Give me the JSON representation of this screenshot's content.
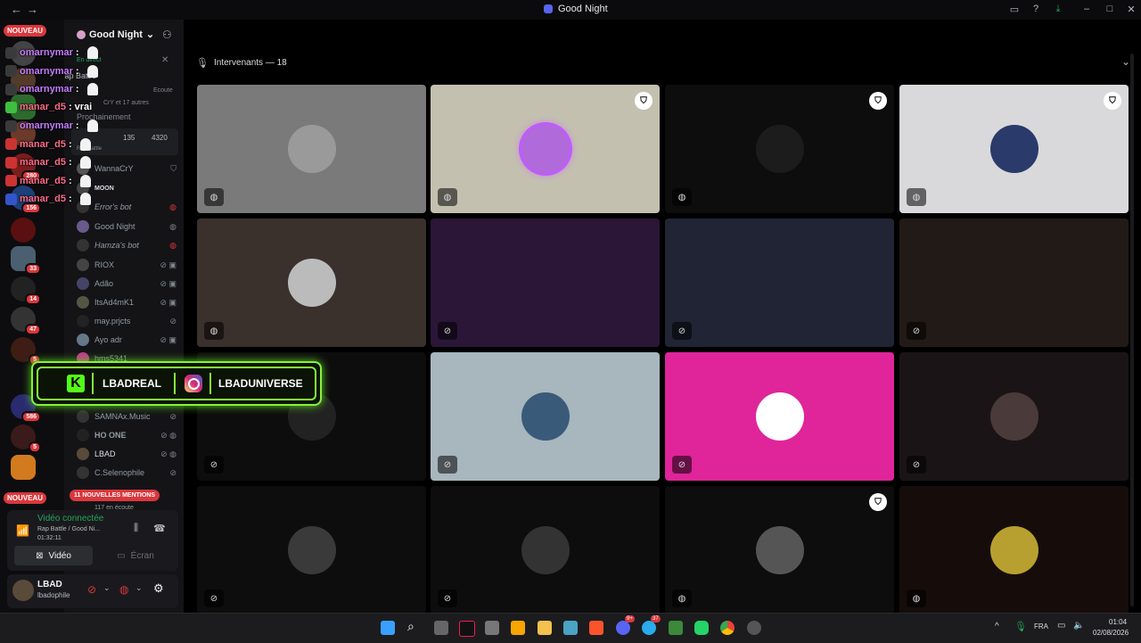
{
  "window": {
    "title": "Good Night",
    "nav_back": "←",
    "nav_forward": "→"
  },
  "rail": {
    "new_label_top": "NOUVEAU",
    "new_label_bottom": "NOUVEAU",
    "badges": [
      "280",
      "156",
      "33",
      "14",
      "47",
      "5",
      "586",
      "5"
    ]
  },
  "sidebar": {
    "server_name": "Good Night",
    "live_label": "En direct",
    "channel_name": "Rap Battle",
    "listening_label": "Ecoute",
    "listeners_summary": "CrY et 17 autres",
    "stage_channel": "Prochainement",
    "stage_counts": [
      "135",
      "4320"
    ],
    "stage_sub": "Rap Battle",
    "users": [
      {
        "name": "WannaCrY",
        "color": "#8e9297"
      },
      {
        "name": "MOON",
        "color": "#8e9297"
      },
      {
        "name": "Error's bot",
        "color": "#8e9297"
      },
      {
        "name": "Good Night",
        "color": "#8e9297"
      },
      {
        "name": "Hamza's bot",
        "color": "#8e9297"
      },
      {
        "name": "RIOX",
        "color": "#8e9297"
      },
      {
        "name": "Adão",
        "color": "#8e9297"
      },
      {
        "name": "ItsAd4mK1",
        "color": "#8e9297"
      },
      {
        "name": "may.prjcts",
        "color": "#8e9297"
      },
      {
        "name": "Ayo adr",
        "color": "#8e9297"
      },
      {
        "name": "hms5341",
        "color": "#8e9297"
      },
      {
        "name": "SAMNAx.Music",
        "color": "#8e9297"
      },
      {
        "name": "HO ONE",
        "color": "#8e9297"
      },
      {
        "name": "LBAD",
        "color": "#8e9297"
      },
      {
        "name": "C.Selenophile",
        "color": "#8e9297"
      },
      {
        "name": "117 en écoute",
        "color": "#8e9297"
      }
    ],
    "mentions_pill": "11 NOUVELLES MENTIONS"
  },
  "voice_panel": {
    "status": "Vidéo connectée",
    "channel": "Rap Battle / Good Ni...",
    "timer": "01:32:11",
    "video_button": "Vidéo",
    "screen_button": "Écran"
  },
  "user_panel": {
    "display_name": "LBAD",
    "username": "lbadophile"
  },
  "main": {
    "speakers_header": "Intervenants — 18"
  },
  "chat": [
    {
      "user": "omarnymar",
      "sep": " :",
      "msg": "",
      "color": "#c77dff"
    },
    {
      "user": "omarnymar",
      "sep": " :",
      "msg": "",
      "color": "#c77dff"
    },
    {
      "user": "omarnymar",
      "sep": " :",
      "msg": "",
      "color": "#c77dff"
    },
    {
      "user": "manar_d5",
      "sep": " :",
      "msg": "vrai",
      "color": "#ff6b8a"
    },
    {
      "user": "omarnymar",
      "sep": " :",
      "msg": "",
      "color": "#c77dff"
    },
    {
      "user": "manar_d5",
      "sep": " :",
      "msg": "",
      "color": "#ff6b8a"
    },
    {
      "user": "manar_d5",
      "sep": " :",
      "msg": "",
      "color": "#ff6b8a"
    },
    {
      "user": "manar_d5",
      "sep": " :",
      "msg": "",
      "color": "#ff6b8a"
    },
    {
      "user": "manar_d5",
      "sep": " :",
      "msg": "",
      "color": "#ff6b8a"
    }
  ],
  "social": {
    "kick_handle": "LBADREAL",
    "instagram_handle": "LBADUNIVERSE"
  },
  "tiles": [
    {
      "label": "tile-1",
      "bg": "#7a7a7a",
      "muted": false,
      "shield": false
    },
    {
      "label": "tile-2",
      "bg": "#c4c0b0",
      "muted": false,
      "shield": true
    },
    {
      "label": "tile-3",
      "bg": "#0d0d0d",
      "muted": false,
      "shield": true
    },
    {
      "label": "tile-4",
      "bg": "#d9d9dc",
      "muted": false,
      "shield": true
    },
    {
      "label": "tile-5",
      "bg": "#3a302c",
      "muted": false,
      "shield": false
    },
    {
      "label": "tile-6",
      "bg": "#2b1638",
      "muted": true,
      "shield": false
    },
    {
      "label": "tile-7",
      "bg": "#202434",
      "muted": true,
      "shield": false
    },
    {
      "label": "tile-8",
      "bg": "#221a16",
      "muted": true,
      "shield": false
    },
    {
      "label": "tile-9",
      "bg": "#0d0d0d",
      "muted": true,
      "shield": false
    },
    {
      "label": "tile-10",
      "bg": "#a8b6bd",
      "muted": true,
      "shield": false
    },
    {
      "label": "tile-11",
      "bg": "#e0249a",
      "muted": true,
      "shield": false
    },
    {
      "label": "tile-12",
      "bg": "#1a1416",
      "muted": true,
      "shield": false
    },
    {
      "label": "tile-13",
      "bg": "#0d0d0d",
      "muted": true,
      "shield": false
    },
    {
      "label": "tile-14",
      "bg": "#0d0d0d",
      "muted": true,
      "shield": false
    },
    {
      "label": "tile-15",
      "bg": "#0d0d0d",
      "muted": false,
      "shield": true
    },
    {
      "label": "tile-16",
      "bg": "#160d0b",
      "muted": false,
      "shield": false
    }
  ],
  "taskbar": {
    "language": "FRA",
    "time": "01:04",
    "date": "02/08/2026",
    "badge_discord": "9+",
    "badge_telegram": "37"
  },
  "colors": {
    "discord_blurple": "#5865f2",
    "green_connected": "#23a55a",
    "mention_red": "#da373c",
    "neon_green": "#86f23b"
  }
}
